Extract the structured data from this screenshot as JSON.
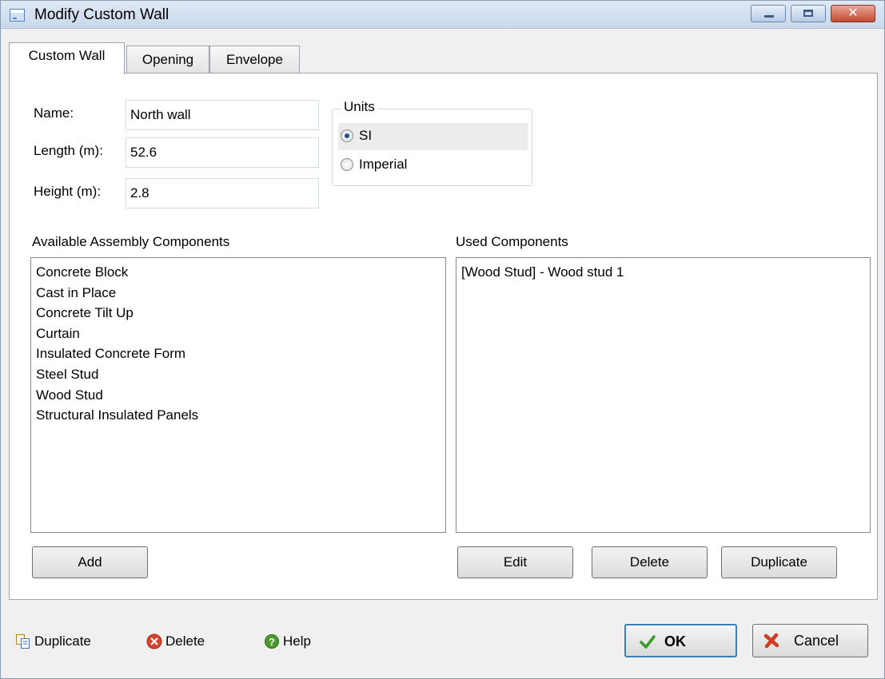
{
  "window": {
    "title": "Modify Custom Wall",
    "close_glyph": "✕"
  },
  "tabs": [
    {
      "label": "Custom Wall",
      "active": true
    },
    {
      "label": "Opening",
      "active": false
    },
    {
      "label": "Envelope",
      "active": false
    }
  ],
  "form": {
    "name_label": "Name:",
    "name_value": "North wall",
    "length_label": "Length (m):",
    "length_value": "52.6",
    "height_label": "Height (m):",
    "height_value": "2.8"
  },
  "units": {
    "title": "Units",
    "options": [
      {
        "label": "SI",
        "selected": true
      },
      {
        "label": "Imperial",
        "selected": false
      }
    ]
  },
  "available": {
    "label": "Available Assembly Components",
    "items": [
      "Concrete Block",
      "Cast in Place",
      "Concrete Tilt Up",
      "Curtain",
      "Insulated Concrete Form",
      "Steel Stud",
      "Wood Stud",
      "Structural Insulated Panels"
    ],
    "add_label": "Add"
  },
  "used": {
    "label": "Used Components",
    "items": [
      "[Wood Stud] - Wood stud 1"
    ],
    "edit_label": "Edit",
    "delete_label": "Delete",
    "duplicate_label": "Duplicate"
  },
  "footer": {
    "duplicate_label": "Duplicate",
    "delete_label": "Delete",
    "help_label": "Help",
    "ok_label": "OK",
    "cancel_label": "Cancel"
  },
  "icons": {
    "duplicate": "duplicate-icon",
    "delete": "delete-icon",
    "help": "help-icon",
    "ok": "checkmark-icon",
    "cancel": "cancel-icon"
  },
  "colors": {
    "ok_border": "#3c7fb1",
    "delete_red": "#d9442c",
    "help_green": "#4a9a2c",
    "check_green": "#3a9a2a"
  }
}
